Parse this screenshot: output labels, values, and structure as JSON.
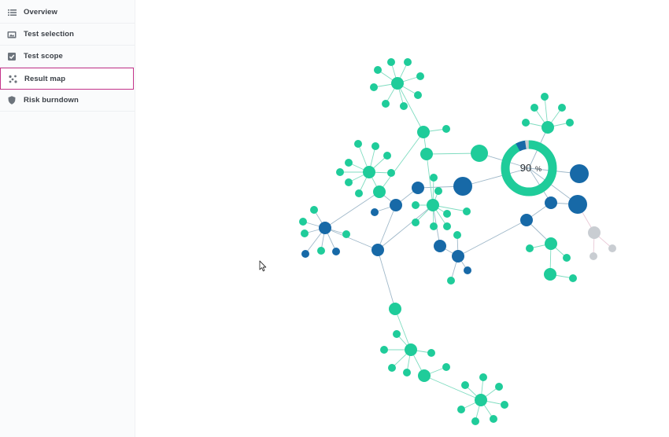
{
  "sidebar": {
    "items": [
      {
        "label": "Overview",
        "icon": "list-icon",
        "active": false
      },
      {
        "label": "Test selection",
        "icon": "image-icon",
        "active": false
      },
      {
        "label": "Test scope",
        "icon": "checkbox-icon",
        "active": false
      },
      {
        "label": "Result map",
        "icon": "network-icon",
        "active": true
      },
      {
        "label": "Risk burndown",
        "icon": "shield-icon",
        "active": false
      }
    ]
  },
  "result_map": {
    "center_value": 90,
    "center_unit": "%",
    "colors": {
      "passed": "#1fcc9a",
      "blue": "#1769a7",
      "inactive": "#c9cdd2",
      "edge": "#9fb8c9"
    }
  },
  "theme": {
    "active_border": "#c4338a"
  }
}
